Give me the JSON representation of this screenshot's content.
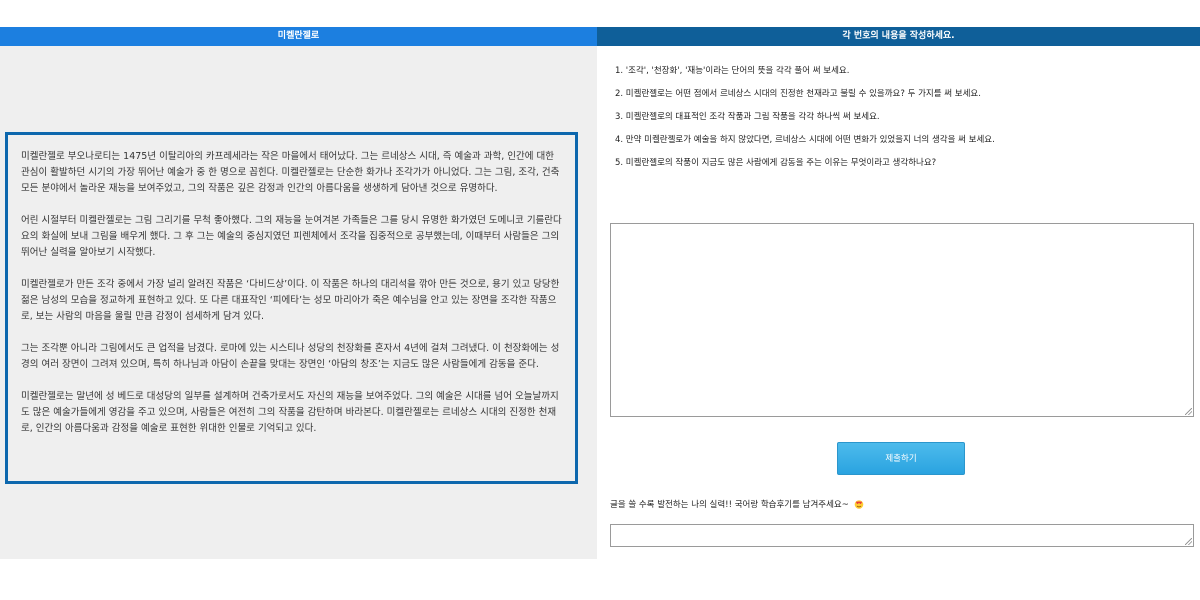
{
  "left": {
    "title": "미켈란젤로",
    "paragraphs": [
      "미켈란젤로 부오나로티는 1475년 이탈리아의 카프레세라는 작은 마을에서 태어났다. 그는 르네상스 시대, 즉 예술과 과학, 인간에 대한 관심이 활발하던 시기의 가장 뛰어난 예술가 중 한 명으로 꼽힌다. 미켈란젤로는 단순한 화가나 조각가가 아니었다. 그는 그림, 조각, 건축 모든 분야에서 놀라운 재능을 보여주었고, 그의 작품은 깊은 감정과 인간의 아름다움을 생생하게 담아낸 것으로 유명하다.",
      "어린 시절부터 미켈란젤로는 그림 그리기를 무척 좋아했다. 그의 재능을 눈여겨본 가족들은 그를 당시 유명한 화가였던 도메니코 기를란다요의 화실에 보내 그림을 배우게 했다. 그 후 그는 예술의 중심지였던 피렌체에서 조각을 집중적으로 공부했는데, 이때부터 사람들은 그의 뛰어난 실력을 알아보기 시작했다.",
      "미켈란젤로가 만든 조각 중에서 가장 널리 알려진 작품은 ‘다비드상’이다. 이 작품은 하나의 대리석을 깎아 만든 것으로, 용기 있고 당당한 젊은 남성의 모습을 정교하게 표현하고 있다. 또 다른 대표작인 ‘피에타’는 성모 마리아가 죽은 예수님을 안고 있는 장면을 조각한 작품으로, 보는 사람의 마음을 울릴 만큼 감정이 섬세하게 담겨 있다.",
      "그는 조각뿐 아니라 그림에서도 큰 업적을 남겼다. 로마에 있는 시스티나 성당의 천장화를 혼자서 4년에 걸쳐 그려냈다. 이 천장화에는 성경의 여러 장면이 그려져 있으며, 특히 하나님과 아담이 손끝을 맞대는 장면인 ‘아담의 창조’는 지금도 많은 사람들에게 감동을 준다.",
      "미켈란젤로는 말년에 성 베드로 대성당의 일부를 설계하며 건축가로서도 자신의 재능을 보여주었다. 그의 예술은 시대를 넘어 오늘날까지도 많은 예술가들에게 영감을 주고 있으며, 사람들은 여전히 그의 작품을 감탄하며 바라본다. 미켈란젤로는 르네상스 시대의 진정한 천재로, 인간의 아름다움과 감정을 예술로 표현한 위대한 인물로 기억되고 있다."
    ]
  },
  "right": {
    "title": "각 번호의 내용을 작성하세요.",
    "questions": [
      "1. '조각', '천장화', '재능'이라는 단어의 뜻을 각각 풀어 써 보세요.",
      "2. 미켈란젤로는 어떤 점에서 르네상스 시대의 진정한 천재라고 불릴 수 있을까요? 두 가지를 써 보세요.",
      "3. 미켈란젤로의 대표적인 조각 작품과 그림 작품을 각각 하나씩 써 보세요.",
      "4. 만약 미켈란젤로가 예술을 하지 않았다면, 르네상스 시대에 어떤 변화가 있었을지 너의 생각을 써 보세요.",
      "5. 미켈란젤로의 작품이 지금도 많은 사람에게 감동을 주는 이유는 무엇이라고 생각하나요?"
    ],
    "answer_value": "",
    "submit_label": "제출하기",
    "review_label": "글을 쓸 수록 발전하는 나의 실력!! 국어랑 학습후기를 남겨주세요~",
    "review_icon": "heart-face-icon",
    "review_value": ""
  },
  "colors": {
    "left_header": "#1c7fe0",
    "right_header": "#0f5f99",
    "passage_border": "#0d67ad",
    "button": "#2aa3e0"
  }
}
